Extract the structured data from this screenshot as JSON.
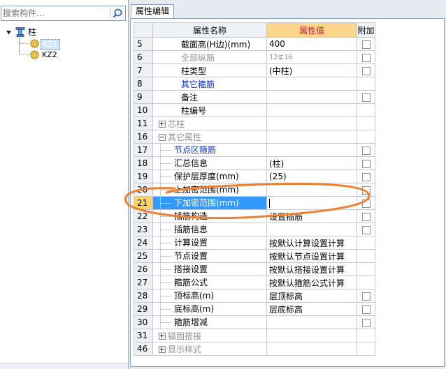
{
  "search": {
    "placeholder": "搜索构件..."
  },
  "tree": {
    "root": "柱",
    "items": [
      {
        "label": "KZ1"
      },
      {
        "label": "KZ2"
      }
    ]
  },
  "tab": {
    "label": "属性编辑"
  },
  "grid": {
    "headers": {
      "name": "属性名称",
      "value": "属性值",
      "add": "附加"
    },
    "rows": [
      {
        "num": "5",
        "name": "截面高(H边)(mm)",
        "value": "400"
      },
      {
        "num": "6",
        "name": "全部纵筋",
        "value": "12⊈16"
      },
      {
        "num": "7",
        "name": "柱类型",
        "value": "(中柱)"
      },
      {
        "num": "8",
        "name": "其它箍筋",
        "value": ""
      },
      {
        "num": "9",
        "name": "备注",
        "value": ""
      },
      {
        "num": "10",
        "name": "柱编号",
        "value": ""
      },
      {
        "num": "11",
        "name": "芯柱",
        "value": ""
      },
      {
        "num": "16",
        "name": "其它属性",
        "value": ""
      },
      {
        "num": "17",
        "name": "节点区箍筋",
        "value": ""
      },
      {
        "num": "18",
        "name": "汇总信息",
        "value": "(柱)"
      },
      {
        "num": "19",
        "name": "保护层厚度(mm)",
        "value": "(25)"
      },
      {
        "num": "20",
        "name": "上加密范围(mm)",
        "value": ""
      },
      {
        "num": "21",
        "name": "下加密范围(mm)",
        "value": ""
      },
      {
        "num": "22",
        "name": "插筋构造",
        "value": "设置插筋"
      },
      {
        "num": "23",
        "name": "插筋信息",
        "value": ""
      },
      {
        "num": "24",
        "name": "计算设置",
        "value": "按默认计算设置计算"
      },
      {
        "num": "25",
        "name": "节点设置",
        "value": "按默认节点设置计算"
      },
      {
        "num": "26",
        "name": "搭接设置",
        "value": "按默认搭接设置计算"
      },
      {
        "num": "27",
        "name": "箍筋公式",
        "value": "按默认箍筋公式计算"
      },
      {
        "num": "28",
        "name": "顶标高(m)",
        "value": "层顶标高"
      },
      {
        "num": "29",
        "name": "底标高(m)",
        "value": "层底标高"
      },
      {
        "num": "30",
        "name": "箍筋增减",
        "value": ""
      },
      {
        "num": "31",
        "name": "锚固搭接",
        "value": ""
      },
      {
        "num": "46",
        "name": "显示样式",
        "value": ""
      }
    ]
  },
  "colors": {
    "selection": "#3399ff",
    "header_value_bg": "#fdd58a",
    "annotation": "#f08030",
    "blue_text": "#0a2ee0"
  },
  "icons": [
    "search-icon",
    "collapse-icon",
    "column-icon",
    "component-icon",
    "checkbox",
    "expand-icon"
  ]
}
